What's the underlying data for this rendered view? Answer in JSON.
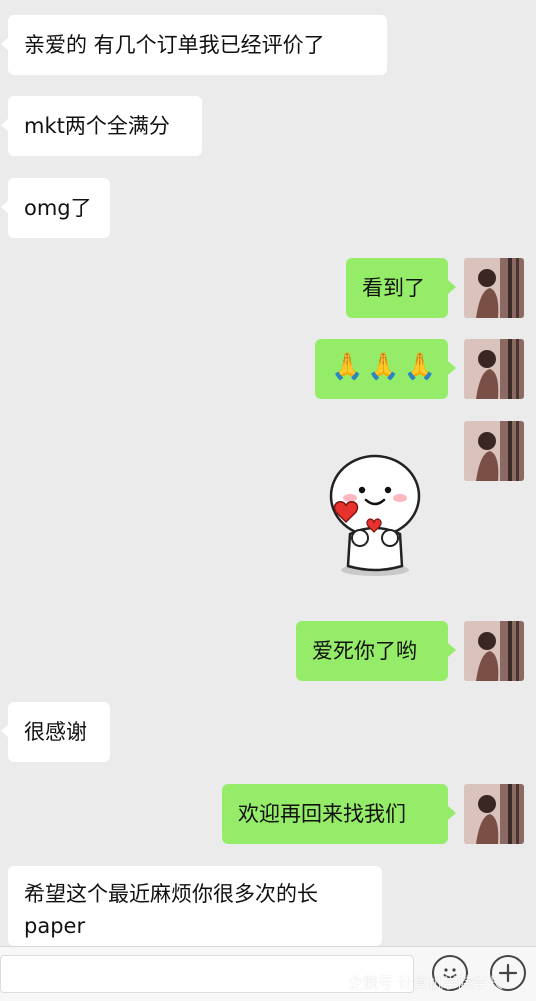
{
  "messages": [
    {
      "text": "亲爱的 有几个订单我已经评价了"
    },
    {
      "text": "mkt两个全满分"
    },
    {
      "text": "omg了"
    },
    {
      "text": "看到了"
    },
    {
      "text": "🙏🙏🙏"
    },
    {
      "text": "爱死你了哟"
    },
    {
      "text": "很感谢"
    },
    {
      "text": "欢迎再回来找我们"
    },
    {
      "text": "希望这个最近麻烦你很多次的长paper"
    }
  ],
  "input": {
    "placeholder": ""
  },
  "icons": {
    "emoji": "smile-face-icon",
    "plus": "plus-icon"
  },
  "watermark": {
    "text": "企鹅号 计算机学院学长"
  },
  "colors": {
    "incoming_bubble": "#ffffff",
    "outgoing_bubble": "#95ec69",
    "background": "#ebebeb"
  }
}
